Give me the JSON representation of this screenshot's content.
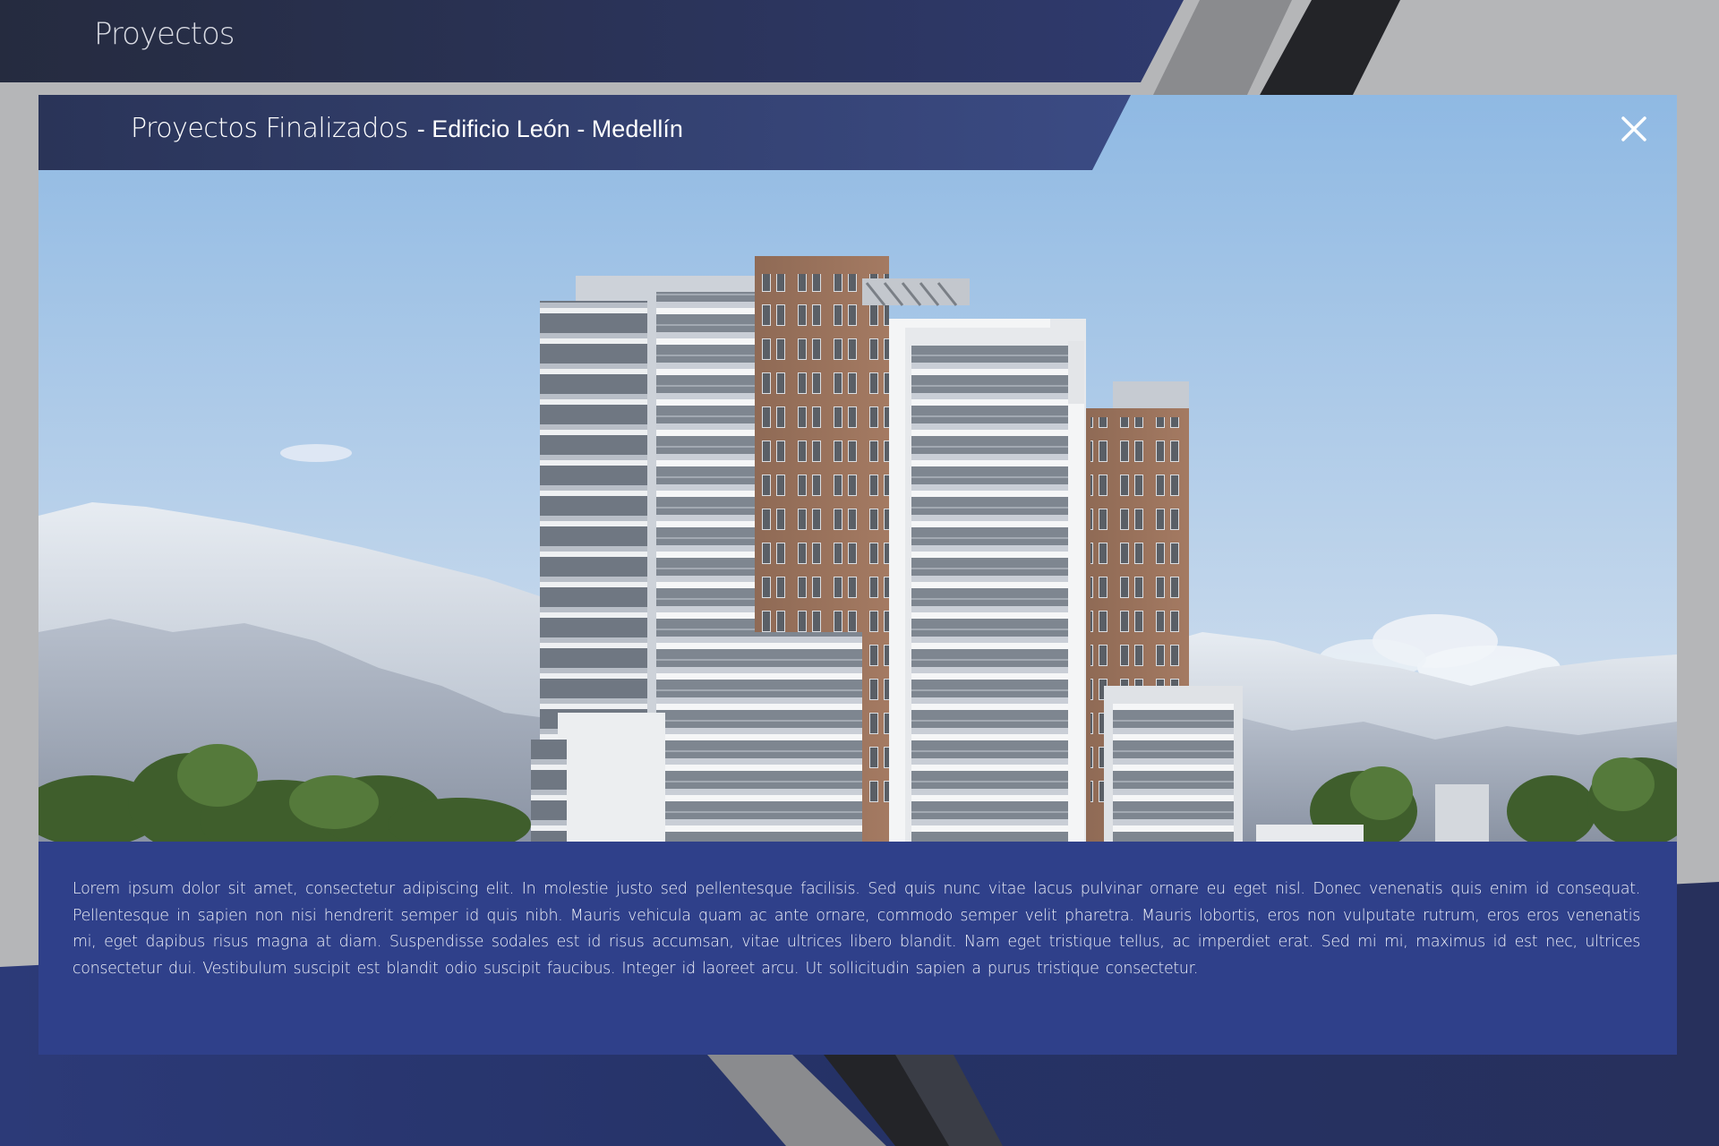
{
  "header": {
    "title": "Proyectos"
  },
  "modal": {
    "title_main": "Proyectos Finalizados",
    "title_sub": "- Edificio León - Medellín",
    "close_icon": "close-icon",
    "image_alt": "Edificio León",
    "description": "Lorem ipsum dolor sit amet, consectetur adipiscing elit. In molestie justo sed pellentesque facilisis. Sed quis nunc vitae lacus pulvinar ornare eu eget nisl. Donec venenatis quis enim id consequat. Pellentesque in sapien non nisi hendrerit semper id quis nibh. Mauris vehicula quam ac ante ornare, commodo semper velit pharetra. Mauris lobortis, eros non vulputate rutrum, eros eros venenatis mi, eget dapibus risus magna at diam. Suspendisse sodales est id risus accumsan, vitae ultrices libero blandit. Nam eget tristique tellus, ac imperdiet erat. Sed mi mi, maximus id est nec, ultrices consectetur dui. Vestibulum suscipit est blandit odio suscipit faucibus. Integer id laoreet arcu. Ut sollicitudin sapien a purus tristique consectetur."
  },
  "colors": {
    "header_band": "#2a3356",
    "modal_panel": "#2f408a",
    "page_background": "#b5b6b8",
    "text_light": "#ffffff"
  }
}
